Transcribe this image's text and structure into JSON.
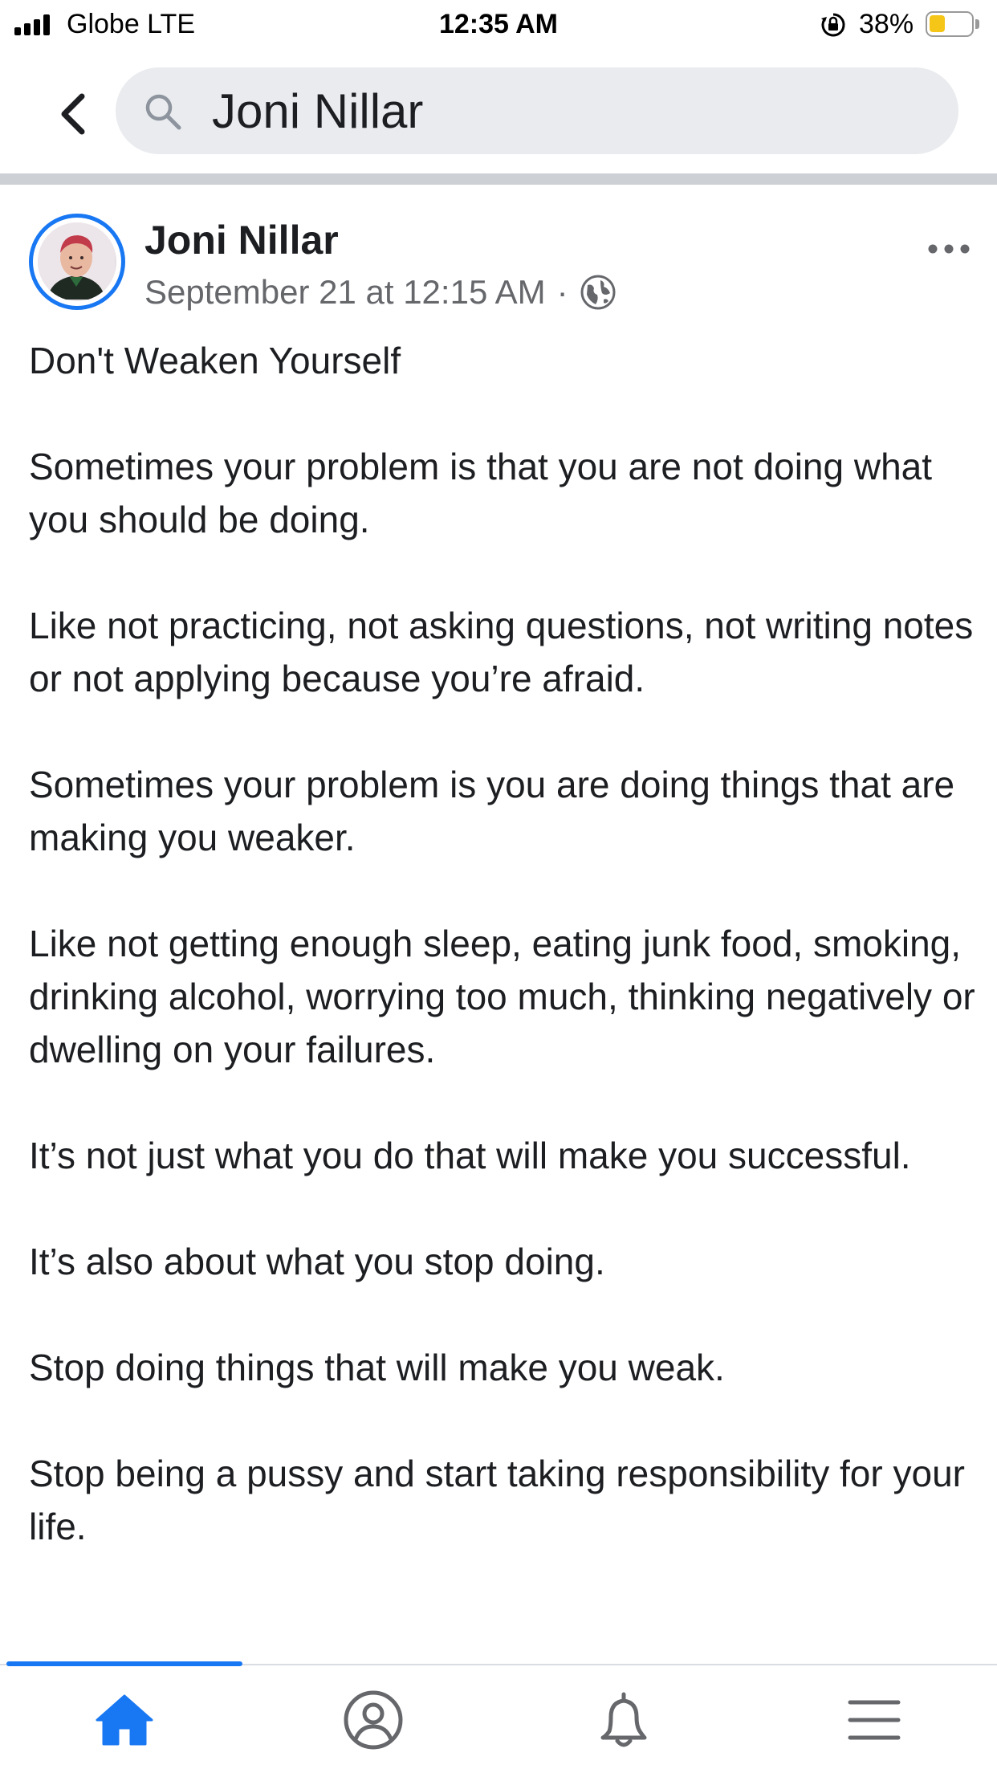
{
  "status_bar": {
    "carrier": "Globe LTE",
    "time": "12:35 AM",
    "battery_percent": "38%",
    "battery_level": 0.38,
    "battery_color": "#f5c518"
  },
  "header": {
    "back_icon": "chevron-left-icon",
    "search_icon": "search-icon",
    "search_value": "Joni Nillar"
  },
  "post": {
    "author": "Joni Nillar",
    "timestamp": "September 21 at 12:15 AM",
    "separator": "·",
    "privacy_icon": "globe-icon",
    "more_icon": "more-horizontal-icon",
    "paragraphs": [
      "Don't Weaken Yourself",
      "Sometimes your problem is that you are not doing what you should be doing.",
      "Like not practicing, not asking questions, not writing notes or not applying because you’re afraid.",
      "Sometimes your problem is you are doing things that are making you weaker.",
      "Like not getting enough sleep, eating junk food, smoking, drinking alcohol, worrying too much, thinking negatively or dwelling on your failures.",
      "It’s not just what you do that will make you successful.",
      "It’s also about what you stop doing.",
      "Stop doing things that will make you weak.",
      "Stop being a pussy and start taking responsibility for your life."
    ]
  },
  "tabbar": {
    "active_tab": "home",
    "tabs": [
      {
        "name": "home",
        "icon": "home-icon"
      },
      {
        "name": "profile",
        "icon": "profile-icon"
      },
      {
        "name": "notifications",
        "icon": "bell-icon"
      },
      {
        "name": "menu",
        "icon": "menu-icon"
      }
    ],
    "accent_color": "#1877f2"
  }
}
